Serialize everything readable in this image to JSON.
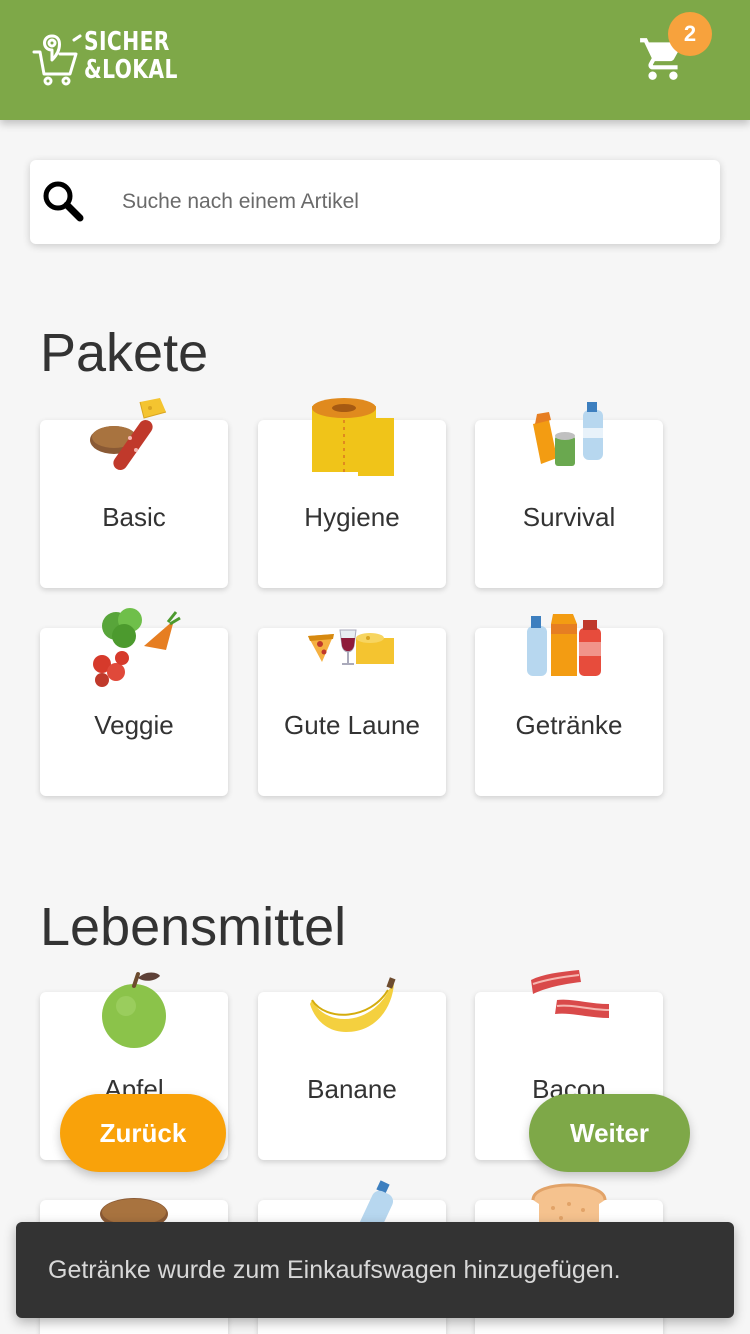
{
  "header": {
    "logo_line1": "SICHER",
    "logo_line2": "&LOKAL",
    "cart_count": "2"
  },
  "search": {
    "placeholder": "Suche nach einem Artikel"
  },
  "sections": {
    "pakete": {
      "title": "Pakete",
      "items": [
        {
          "label": "Basic",
          "icon": "bread-cheese-salami-icon"
        },
        {
          "label": "Hygiene",
          "icon": "toilet-paper-icon"
        },
        {
          "label": "Survival",
          "icon": "juice-can-water-icon"
        },
        {
          "label": "Veggie",
          "icon": "vegetables-icon"
        },
        {
          "label": "Gute Laune",
          "icon": "pizza-wine-cheese-icon"
        },
        {
          "label": "Getränke",
          "icon": "drinks-icon"
        }
      ]
    },
    "lebensmittel": {
      "title": "Lebensmittel",
      "items": [
        {
          "label": "Apfel",
          "icon": "apple-icon"
        },
        {
          "label": "Banane",
          "icon": "banana-icon"
        },
        {
          "label": "Bacon",
          "icon": "bacon-icon"
        },
        {
          "label": "",
          "icon": "bread-loaf-icon"
        },
        {
          "label": "",
          "icon": "water-bottle-icon"
        },
        {
          "label": "",
          "icon": "toast-icon"
        }
      ]
    }
  },
  "actions": {
    "back_label": "Zurück",
    "next_label": "Weiter"
  },
  "snackbar": {
    "message": "Getränke wurde zum Einkaufswagen hinzugefügen."
  },
  "colors": {
    "primary": "#7ea848",
    "accent": "#f9a20a",
    "badge": "#f7a23d",
    "snackbar": "#333333"
  }
}
